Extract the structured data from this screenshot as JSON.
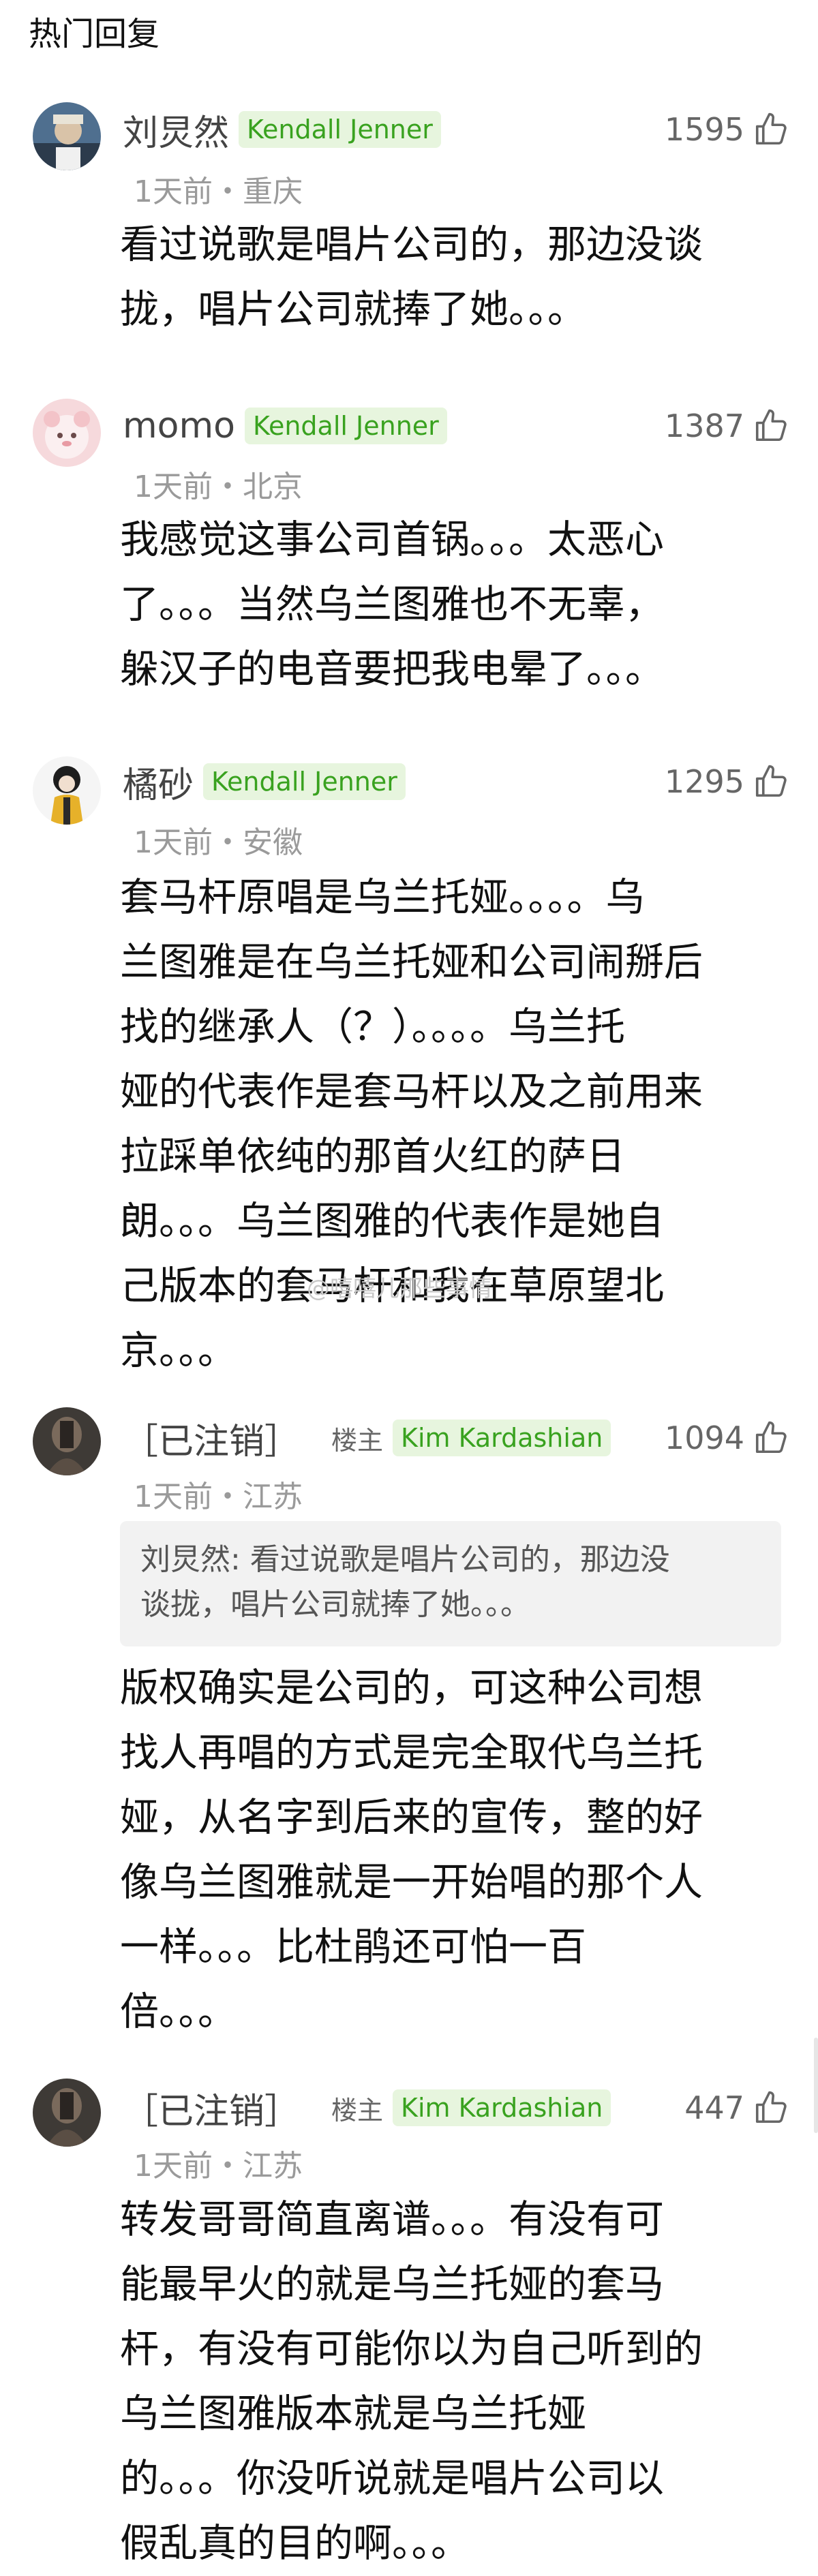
{
  "section_title": "热门回复",
  "watermark": "@嘻嘻儿那些事情",
  "comments": [
    {
      "user": "刘炅然",
      "badge": "Kendall Jenner",
      "likes": "1595",
      "meta": "1天前・重庆",
      "lines": [
        "看过说歌是唱片公司的，那边没谈",
        "拢，唱片公司就捧了她。。。"
      ]
    },
    {
      "user": "momo",
      "badge": "Kendall Jenner",
      "likes": "1387",
      "meta": "1天前・北京",
      "lines": [
        "我感觉这事公司首锅。。。太恶心",
        "了。。。当然乌兰图雅也不无辜，",
        "躲汉子的电音要把我电晕了。。。"
      ]
    },
    {
      "user": "橘砂",
      "badge": "Kendall Jenner",
      "likes": "1295",
      "meta": "1天前・安徽",
      "lines": [
        "套马杆原唱是乌兰托娅。。。。乌",
        "兰图雅是在乌兰托娅和公司闹掰后",
        "找的继承人（？）。。。。乌兰托",
        "娅的代表作是套马杆以及之前用来",
        "拉踩单依纯的那首火红的萨日",
        "朗。。。乌兰图雅的代表作是她自",
        "己版本的套马杆和我在草原望北",
        "京。。。"
      ]
    },
    {
      "user": "［已注销］",
      "owner_tag": "楼主",
      "badge": "Kim Kardashian",
      "likes": "1094",
      "meta": "1天前・江苏",
      "quote_lines": [
        "刘炅然: 看过说歌是唱片公司的，那边没",
        "谈拢，唱片公司就捧了她。。。"
      ],
      "lines": [
        "版权确实是公司的，可这种公司想",
        "找人再唱的方式是完全取代乌兰托",
        "娅，从名字到后来的宣传，整的好",
        "像乌兰图雅就是一开始唱的那个人",
        "一样。。。比杜鹃还可怕一百",
        "倍。。。"
      ]
    },
    {
      "user": "［已注销］",
      "owner_tag": "楼主",
      "badge": "Kim Kardashian",
      "likes": "447",
      "meta": "1天前・江苏",
      "lines": [
        "转发哥哥简直离谱。。。有没有可",
        "能最早火的就是乌兰托娅的套马",
        "杆，有没有可能你以为自己听到的",
        "乌兰图雅版本就是乌兰托娅",
        "的。。。你没听说就是唱片公司以",
        "假乱真的目的啊。。。"
      ]
    }
  ]
}
